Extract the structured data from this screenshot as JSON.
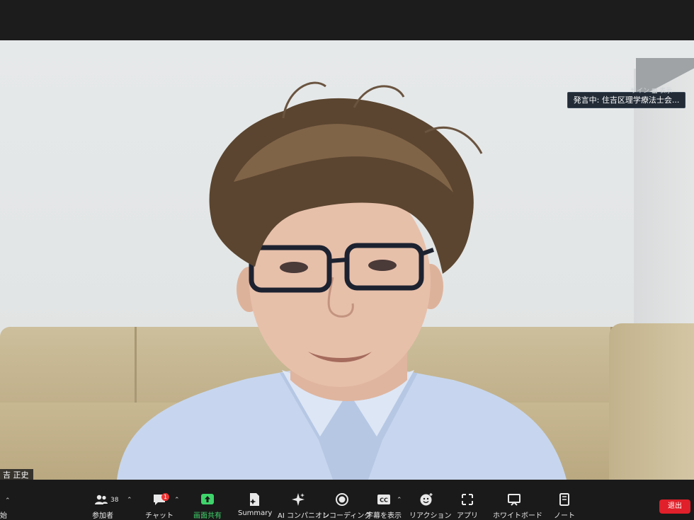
{
  "meeting": {
    "speaking_indicator": "発言中: 住吉区理学療法士会...",
    "corner_controls": "サイン  ▦ 表示",
    "participant_name": "吉 正史"
  },
  "toolbar": {
    "left_cut_label": "始",
    "participants": {
      "label": "参加者",
      "count": "38",
      "icon": "people-icon"
    },
    "chat": {
      "label": "チャット",
      "badge": "1",
      "icon": "chat-icon"
    },
    "share": {
      "label": "画面共有",
      "icon": "share-screen-icon"
    },
    "summary": {
      "label": "Summary",
      "icon": "summary-icon"
    },
    "ai": {
      "label": "AI コンパニオン",
      "icon": "ai-sparkle-icon"
    },
    "record": {
      "label": "レコーディング",
      "icon": "record-icon"
    },
    "captions": {
      "label": "字幕を表示",
      "icon": "cc-icon",
      "icon_text": "CC"
    },
    "reactions": {
      "label": "リアクション",
      "icon": "smiley-icon"
    },
    "apps": {
      "label": "アプリ",
      "icon": "apps-icon"
    },
    "whiteboard": {
      "label": "ホワイトボード",
      "icon": "whiteboard-icon"
    },
    "notes": {
      "label": "ノート",
      "icon": "notes-icon"
    },
    "leave": {
      "label": "退出"
    }
  },
  "colors": {
    "leave": "#e0202a",
    "share_green": "#3fd46b",
    "badge_red": "#ee3333"
  }
}
